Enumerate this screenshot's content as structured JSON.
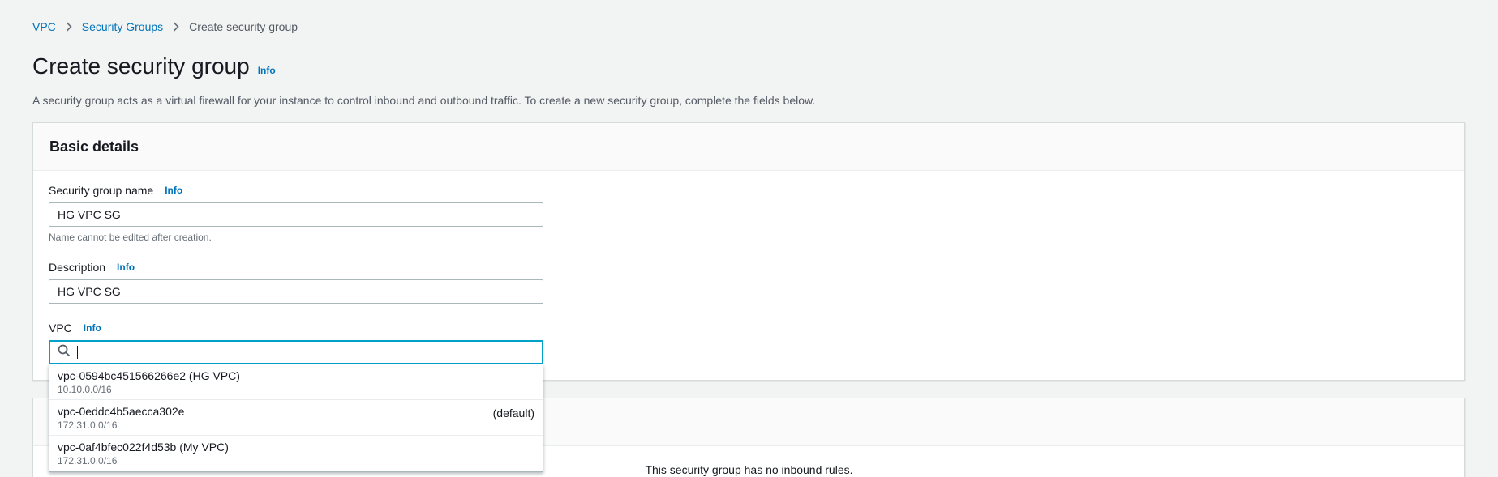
{
  "breadcrumb": {
    "items": [
      "VPC",
      "Security Groups"
    ],
    "current": "Create security group"
  },
  "header": {
    "title": "Create security group",
    "info": "Info",
    "description": "A security group acts as a virtual firewall for your instance to control inbound and outbound traffic. To create a new security group, complete the fields below."
  },
  "basic_details": {
    "title": "Basic details",
    "name_field": {
      "label": "Security group name",
      "info": "Info",
      "value": "HG VPC SG",
      "hint": "Name cannot be edited after creation."
    },
    "description_field": {
      "label": "Description",
      "info": "Info",
      "value": "HG VPC SG"
    },
    "vpc_field": {
      "label": "VPC",
      "info": "Info",
      "search_value": "",
      "options": [
        {
          "name": "vpc-0594bc451566266e2 (HG VPC)",
          "cidr": "10.10.0.0/16",
          "tag": ""
        },
        {
          "name": "vpc-0eddc4b5aecca302e",
          "cidr": "172.31.0.0/16",
          "tag": "(default)"
        },
        {
          "name": "vpc-0af4bfec022f4d53b (My VPC)",
          "cidr": "172.31.0.0/16",
          "tag": ""
        }
      ]
    }
  },
  "inbound": {
    "empty_text": "This security group has no inbound rules."
  },
  "icons": {
    "breadcrumb_separator": "chevron-right-icon",
    "search": "search-icon"
  },
  "colors": {
    "link": "#0073bb",
    "focus_border": "#00a1c9",
    "background": "#f2f3f3"
  }
}
